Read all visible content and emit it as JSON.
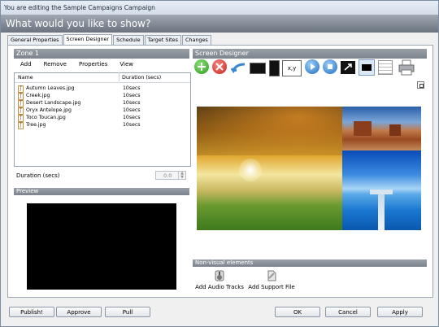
{
  "window": {
    "title": "You are editing the Sample Campaigns Campaign"
  },
  "header": {
    "title": "What would you like to show?"
  },
  "tabs": [
    {
      "label": "General Properties"
    },
    {
      "label": "Screen Designer"
    },
    {
      "label": "Schedule"
    },
    {
      "label": "Target Sites"
    },
    {
      "label": "Changes"
    }
  ],
  "zone": {
    "title": "Zone 1",
    "menu": [
      "Add",
      "Remove",
      "Properties",
      "View"
    ],
    "columns": {
      "name": "Name",
      "duration": "Duration (secs)"
    },
    "files": [
      {
        "name": "Autumn Leaves.jpg",
        "duration": "10secs"
      },
      {
        "name": "Creek.jpg",
        "duration": "10secs"
      },
      {
        "name": "Desert Landscape.jpg",
        "duration": "10secs"
      },
      {
        "name": "Oryx Antelope.jpg",
        "duration": "10secs"
      },
      {
        "name": "Toco Toucan.jpg",
        "duration": "10secs"
      },
      {
        "name": "Tree.jpg",
        "duration": "10secs"
      }
    ],
    "duration_label": "Duration (secs)",
    "duration_value": "0.0"
  },
  "preview": {
    "title": "Preview"
  },
  "designer": {
    "title": "Screen Designer",
    "xy_label": "x,y"
  },
  "nonvisual": {
    "title": "Non-visual elements",
    "items": [
      {
        "label": "Add Audio Tracks",
        "icon": "audio-icon"
      },
      {
        "label": "Add Support File",
        "icon": "support-file-icon"
      }
    ]
  },
  "buttons": {
    "publish": "Publish!",
    "approve": "Approve",
    "pull": "Pull",
    "ok": "OK",
    "cancel": "Cancel",
    "apply": "Apply"
  }
}
